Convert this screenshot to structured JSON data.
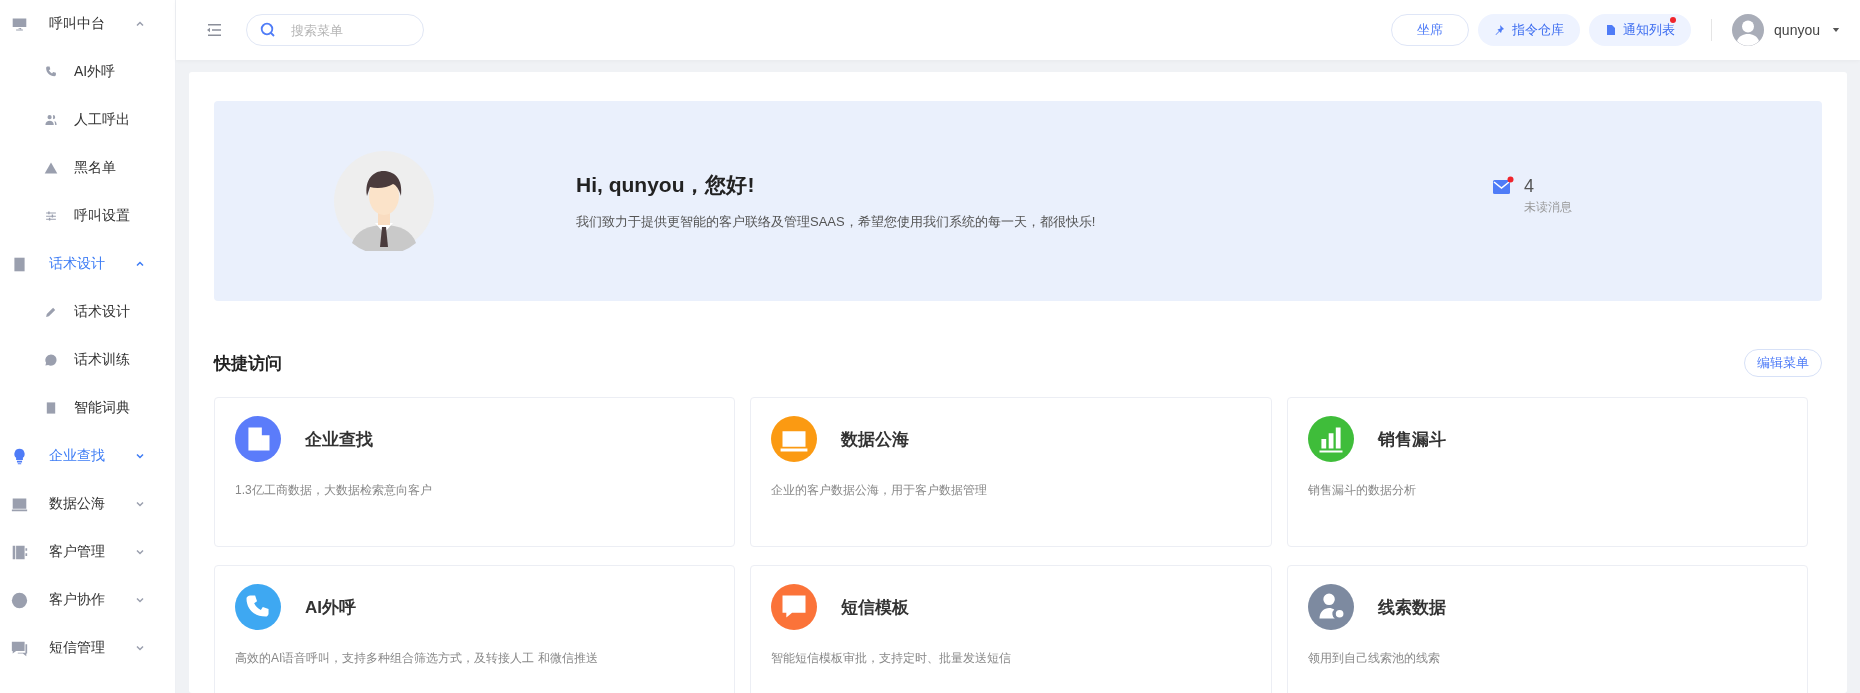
{
  "sidebar": {
    "groups": [
      {
        "label": "呼叫中台",
        "expanded": true,
        "highlighted": false,
        "children": [
          {
            "label": "AI外呼"
          },
          {
            "label": "人工呼出"
          },
          {
            "label": "黑名单"
          },
          {
            "label": "呼叫设置"
          }
        ]
      },
      {
        "label": "话术设计",
        "expanded": true,
        "highlighted": true,
        "children": [
          {
            "label": "话术设计"
          },
          {
            "label": "话术训练"
          },
          {
            "label": "智能词典"
          }
        ]
      },
      {
        "label": "企业查找",
        "expanded": false,
        "highlighted": true
      },
      {
        "label": "数据公海",
        "expanded": false,
        "highlighted": false
      },
      {
        "label": "客户管理",
        "expanded": false,
        "highlighted": false
      },
      {
        "label": "客户协作",
        "expanded": false,
        "highlighted": false
      },
      {
        "label": "短信管理",
        "expanded": false,
        "highlighted": false
      }
    ]
  },
  "topbar": {
    "search": {
      "placeholder": "搜索菜单"
    },
    "buttons": [
      {
        "label": "坐席",
        "kind": "outline",
        "badge": false
      },
      {
        "label": "指令仓库",
        "kind": "pin",
        "badge": false
      },
      {
        "label": "通知列表",
        "kind": "notice",
        "badge": true
      }
    ],
    "user": "qunyou"
  },
  "banner": {
    "greeting": "Hi, qunyou，您好!",
    "message": "我们致力于提供更智能的客户联络及管理SAAS，希望您使用我们系统的每一天，都很快乐!",
    "unread_count": "4",
    "unread_label": "未读消息"
  },
  "quick_access": {
    "title": "快捷访问",
    "edit_button": "编辑菜单",
    "cards": [
      {
        "title": "企业查找",
        "description": "1.3亿工商数据，大数据检索意向客户",
        "color": "#5b7cfa"
      },
      {
        "title": "数据公海",
        "description": "企业的客户数据公海，用于客户数据管理",
        "color": "#fb9a12"
      },
      {
        "title": "销售漏斗",
        "description": "销售漏斗的数据分析",
        "color": "#3fbd3a"
      },
      {
        "title": "AI外呼",
        "description": "高效的AI语音呼叫，支持多种组合筛选方式，及转接人工 和微信推送",
        "color": "#3ea8f2"
      },
      {
        "title": "短信模板",
        "description": "智能短信模板审批，支持定时、批量发送短信",
        "color": "#fb7339"
      },
      {
        "title": "线索数据",
        "description": "领用到自己线索池的线索",
        "color": "#7d8aa0"
      }
    ]
  }
}
